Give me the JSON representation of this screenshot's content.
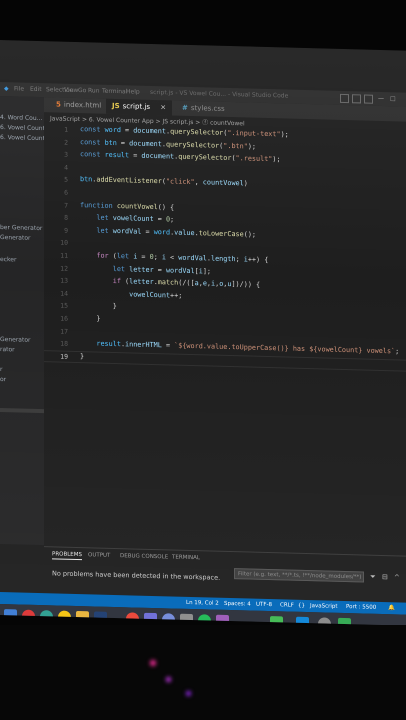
{
  "window_title": "script.js - VS Vowel Cou... - Visual Studio Code",
  "menu": [
    "File",
    "Edit",
    "Selection",
    "View",
    "Go",
    "Run",
    "Terminal",
    "Help"
  ],
  "tabs": [
    {
      "icon": "5",
      "label": "index.html",
      "active": false
    },
    {
      "icon": "JS",
      "label": "script.js",
      "active": true,
      "close": "×"
    },
    {
      "icon": "#",
      "label": "styles.css",
      "active": false
    }
  ],
  "breadcrumb": "JavaScript  >  6. Vowel Counter App  >  JS script.js  >  ⓕ countVowel",
  "sidebar_items": [
    "4. Word Cou...",
    "6. Vowel Count...",
    "6. Vowel Count...",
    "",
    "ber Generator",
    "Generator",
    "",
    "ecker",
    "",
    "",
    "Generator",
    "rator",
    "",
    "r",
    "or"
  ],
  "code_lines": [
    {
      "n": "1",
      "text": "const word = document.querySelector(\".input-text\");"
    },
    {
      "n": "2",
      "text": "const btn = document.querySelector(\".btn\");"
    },
    {
      "n": "3",
      "text": "const result = document.querySelector(\".result\");"
    },
    {
      "n": "4",
      "text": ""
    },
    {
      "n": "5",
      "text": "btn.addEventListener(\"click\", countVowel)"
    },
    {
      "n": "6",
      "text": ""
    },
    {
      "n": "7",
      "text": "function countVowel() {"
    },
    {
      "n": "8",
      "text": "    let vowelCount = 0;"
    },
    {
      "n": "9",
      "text": "    let wordVal = word.value.toLowerCase();"
    },
    {
      "n": "10",
      "text": ""
    },
    {
      "n": "11",
      "text": "    for (let i = 0; i < wordVal.length; i++) {"
    },
    {
      "n": "12",
      "text": "        let letter = wordVal[i];"
    },
    {
      "n": "13",
      "text": "        if (letter.match(/([a,e,i,o,u])/)) {"
    },
    {
      "n": "14",
      "text": "            vowelCount++;"
    },
    {
      "n": "15",
      "text": "        }"
    },
    {
      "n": "16",
      "text": "    }"
    },
    {
      "n": "17",
      "text": ""
    },
    {
      "n": "18",
      "text": "    result.innerHTML = `${word.value.toUpperCase()} has ${vowelCount} vowels`;"
    },
    {
      "n": "19",
      "text": "}"
    }
  ],
  "panel": {
    "tabs": [
      "PROBLEMS",
      "OUTPUT",
      "DEBUG CONSOLE",
      "TERMINAL"
    ],
    "message": "No problems have been detected in the workspace.",
    "filter_placeholder": "Filter (e.g. text, **/*.ts, !**/node_modules/**)"
  },
  "status": {
    "position": "Ln 19, Col 2",
    "spaces": "Spaces: 4",
    "encoding": "UTF-8",
    "eol": "CRLF",
    "language": "JavaScript",
    "port": "Port : 5500"
  },
  "colors": {
    "editor_bg": "#1e1e1e",
    "status_bar": "#0066b8",
    "keyword": "#569cd6",
    "function": "#dcdcaa",
    "variable": "#9cdcfe",
    "string": "#ce9178"
  },
  "taskbar_icons": [
    "windows-start-icon",
    "search-icon",
    "edge-icon",
    "chrome-icon",
    "explorer-icon",
    "photoshop-icon",
    "chrome-icon",
    "store-icon",
    "discord-icon",
    "teams-icon",
    "spotify-icon",
    "game-icon",
    "git-icon",
    "vscode-icon",
    "settings-icon",
    "terminal-icon"
  ]
}
